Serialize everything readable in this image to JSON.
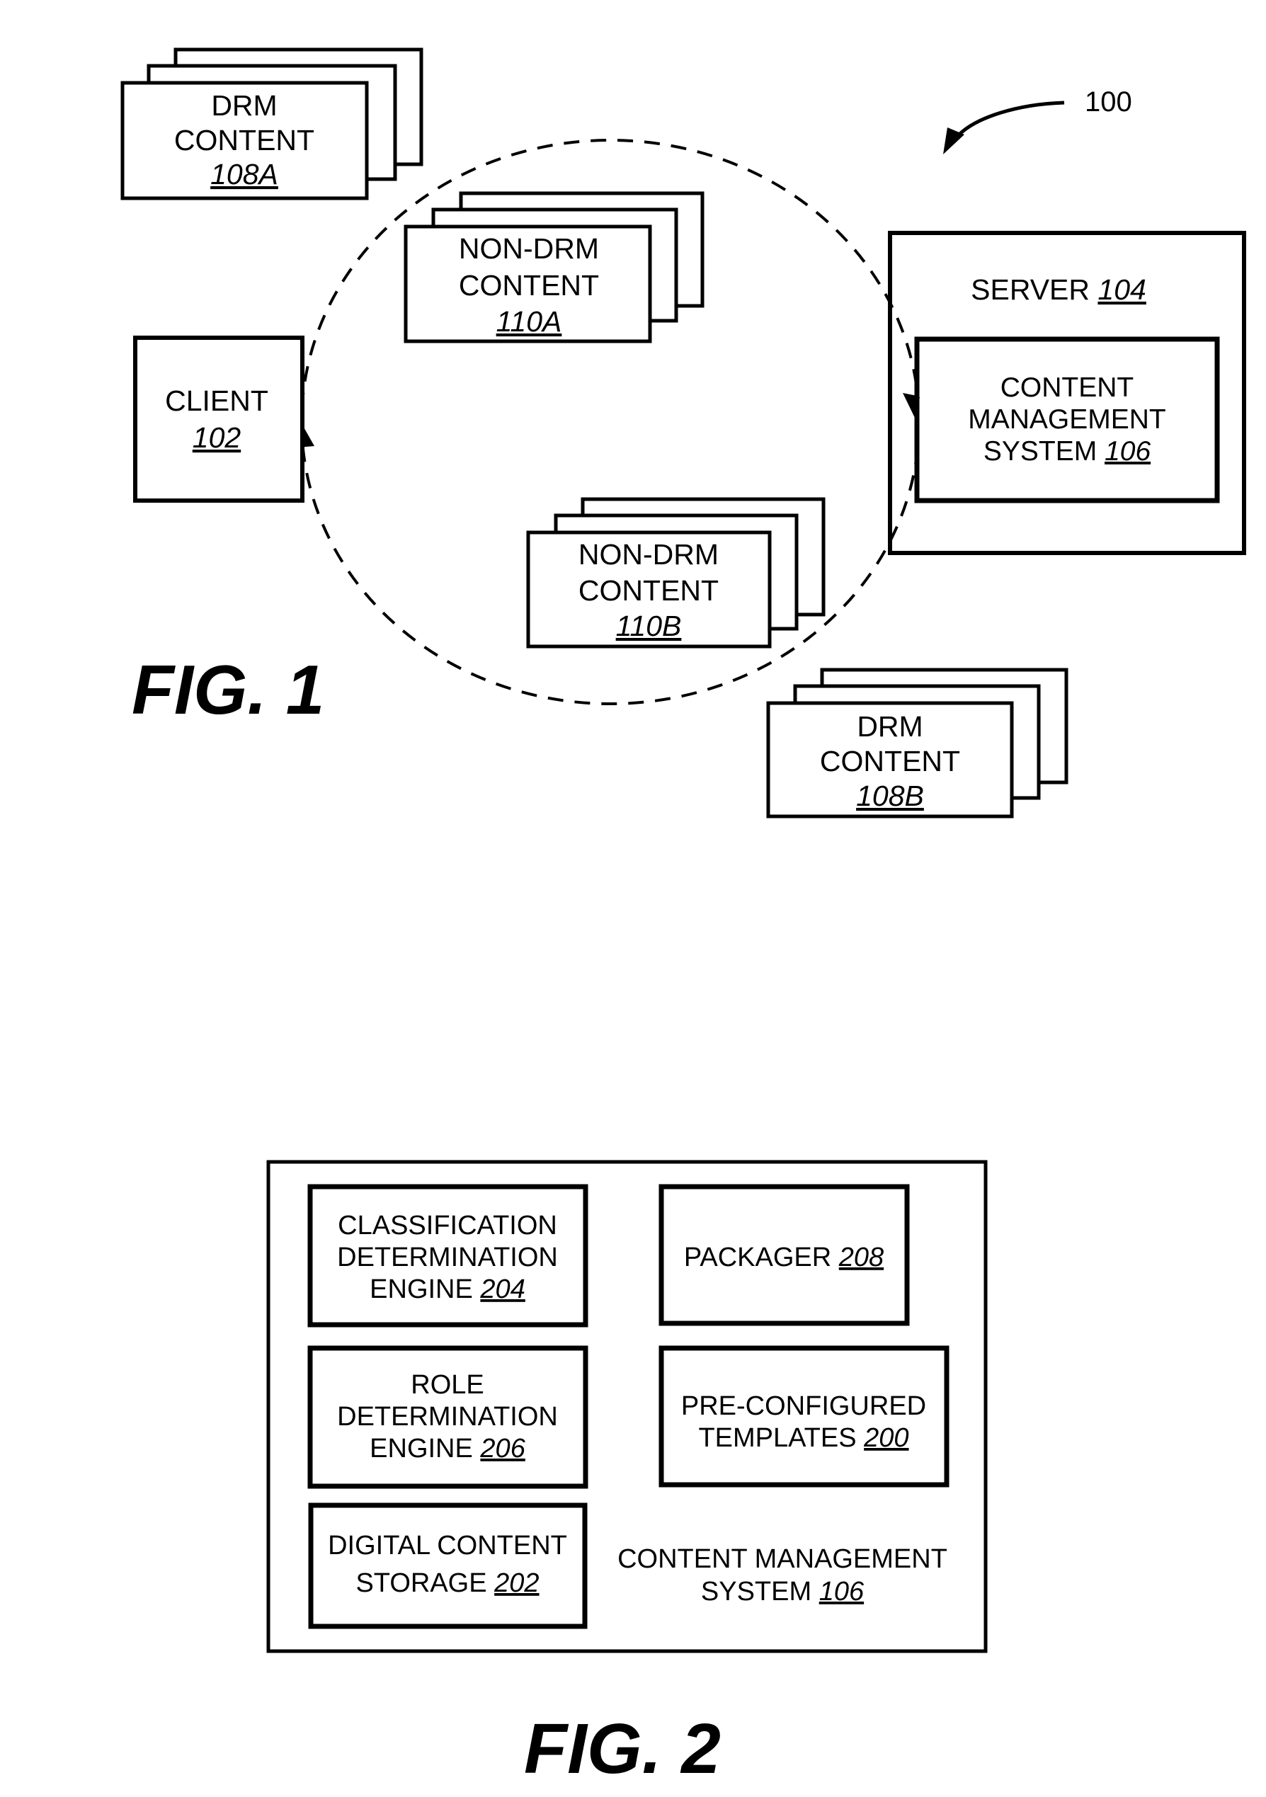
{
  "figure1": {
    "caption": "FIG. 1",
    "system_ref": "100",
    "drm_content_a": {
      "lines": [
        "DRM",
        "CONTENT"
      ],
      "ref": "108A"
    },
    "drm_content_b": {
      "lines": [
        "DRM",
        "CONTENT"
      ],
      "ref": "108B"
    },
    "non_drm_content_a": {
      "lines": [
        "NON-DRM",
        "CONTENT"
      ],
      "ref": "110A"
    },
    "non_drm_content_b": {
      "lines": [
        "NON-DRM",
        "CONTENT"
      ],
      "ref": "110B"
    },
    "client": {
      "lines": [
        "CLIENT"
      ],
      "ref": "102"
    },
    "server": {
      "label": "SERVER",
      "ref": "104"
    },
    "cms": {
      "lines": [
        "CONTENT",
        "MANAGEMENT",
        "SYSTEM"
      ],
      "ref": "106"
    }
  },
  "figure2": {
    "caption": "FIG. 2",
    "classification_engine": {
      "lines": [
        "CLASSIFICATION",
        "DETERMINATION",
        "ENGINE"
      ],
      "ref": "204"
    },
    "role_engine": {
      "lines": [
        "ROLE",
        "DETERMINATION",
        "ENGINE"
      ],
      "ref": "206"
    },
    "digital_content_storage": {
      "lines": [
        "DIGITAL CONTENT",
        "STORAGE"
      ],
      "ref": "202"
    },
    "packager": {
      "lines": [
        "PACKAGER"
      ],
      "ref": "208"
    },
    "preconfigured_templates": {
      "lines": [
        "PRE-CONFIGURED",
        "TEMPLATES"
      ],
      "ref": "200"
    },
    "cms_container": {
      "lines": [
        "CONTENT MANAGEMENT",
        "SYSTEM"
      ],
      "ref": "106"
    }
  }
}
